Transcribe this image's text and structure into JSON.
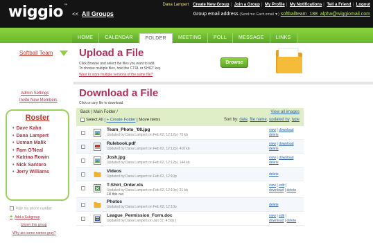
{
  "app": {
    "logo": "wiggio",
    "logo_mark": "™"
  },
  "header": {
    "all_groups_arrow": "<<",
    "all_groups": "All Groups",
    "user": "Dana Lampert",
    "links": [
      "Create New Group",
      "Join a Group",
      "My Profile",
      "My Notifications",
      "Tell a Friend",
      "Logout"
    ],
    "group_email_label": "Group email address",
    "group_email_note": "(Send me: Each email ▼)",
    "group_email": "softballteam_188_alpha@wiggiomail.com"
  },
  "tabs": [
    {
      "label": "HOME",
      "active": false
    },
    {
      "label": "CALENDAR",
      "active": false
    },
    {
      "label": "FOLDER",
      "active": true
    },
    {
      "label": "MEETING",
      "active": false
    },
    {
      "label": "POLL",
      "active": false
    },
    {
      "label": "MESSAGE",
      "active": false
    },
    {
      "label": "LINKS",
      "active": false
    }
  ],
  "sidebar": {
    "team": "Softball Team",
    "admin_settings": "Admin Settings",
    "invite": "Invite New Members",
    "roster_title": "Roster",
    "roster": [
      "Dave Kahn",
      "Dana Lampert",
      "Usman Malik",
      "Pam O'Neal",
      "Katrina Rowin",
      "Nick Santoro",
      "Jerry Williams"
    ],
    "hide_phone": "Hide my phone number",
    "add_subgroup": "Add a Subgroup",
    "unjoin": "Unjoin this group",
    "why_gray": "Why are some names gray?"
  },
  "upload": {
    "title": "Upload a File",
    "desc1": "Click Browse and select the files you want to add.",
    "desc2": "To choose multiple files, hold the CTRL or SHIFT key.",
    "why": "Want to store multiple versions of the same file?",
    "browse": "Browse"
  },
  "download": {
    "title": "Download a File",
    "subtitle": "Click on any file to download",
    "crumb_back": "Back",
    "crumb_folder": "Main Folder /",
    "view_all_images": "View all images",
    "select_all": "Select All",
    "create_folder": "+ Create Folder",
    "move_items": "Move Items",
    "sort_label": "Sort by:",
    "sort_options": [
      "date",
      "file name",
      "updated by",
      "type"
    ]
  },
  "files": [
    {
      "name": "Team_Photo_'08.jpg",
      "meta": "Updated by Dana Lampert on Feb 02, 12:12p | 70 kb",
      "note": "",
      "icon": "image-file-icon",
      "actions": [
        "view",
        "download",
        "delete"
      ]
    },
    {
      "name": "Rulebook.pdf",
      "meta": "Updated by Dana Lampert on Feb 02, 12:12p | 410 kb",
      "note": "",
      "icon": "pdf-file-icon",
      "actions": [
        "view",
        "download",
        "delete"
      ]
    },
    {
      "name": "Josh.jpg",
      "meta": "Updated by Dana Lampert on Feb 02, 12:12p | 144 kb",
      "note": "",
      "icon": "image-file-icon",
      "actions": [
        "view",
        "download",
        "delete"
      ]
    },
    {
      "name": "Videos",
      "meta": "Updated by Dana Lampert on Feb 02, 12:10p",
      "note": "",
      "icon": "folder-icon",
      "actions": [
        "delete"
      ]
    },
    {
      "name": "T-Shirt_Order.xls",
      "meta": "Updated by Dana Lampert on Feb 02, 12:10p | 21 kb",
      "note": "Fill this out",
      "icon": "spreadsheet-file-icon",
      "actions": [
        "view",
        "edit",
        "download",
        "delete"
      ]
    },
    {
      "name": "Photos",
      "meta": "Updated by Dana Lampert on Feb 02, 12:10p",
      "note": "",
      "icon": "folder-icon",
      "actions": [
        "delete"
      ]
    },
    {
      "name": "League_Permission_Form.doc",
      "meta": "Updated by Dana Lampert on Jan 07, 4:50p |",
      "note": "",
      "icon": "doc-file-icon",
      "actions": [
        "view",
        "edit",
        "download",
        "delete"
      ]
    }
  ],
  "colors": {
    "brand_green": "#8cd23e",
    "accent_red": "#b0305a",
    "link_blue": "#3366aa"
  }
}
